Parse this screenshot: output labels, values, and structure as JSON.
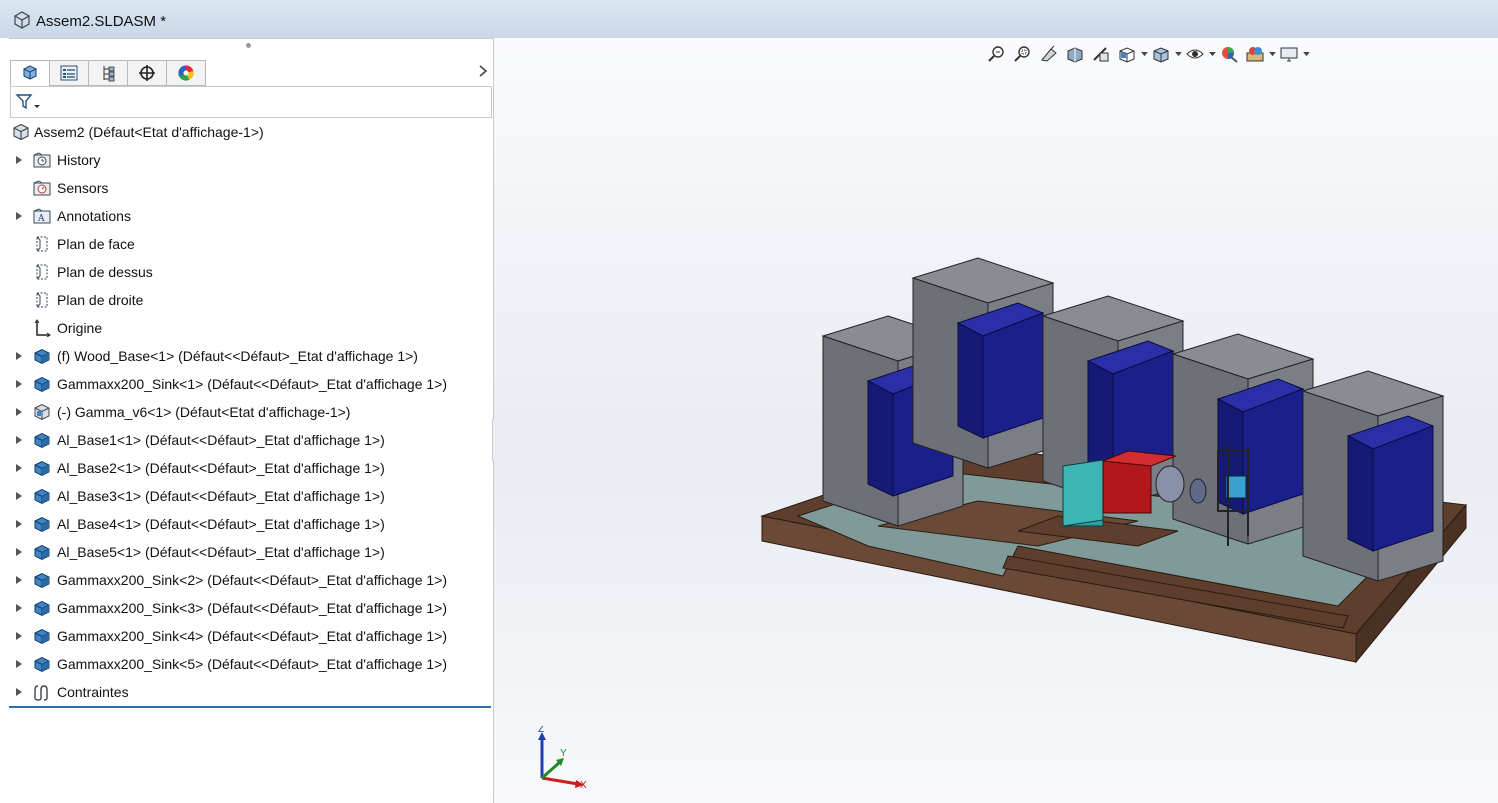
{
  "window": {
    "title": "Assem2.SLDASM *",
    "icon": "assembly-icon"
  },
  "manager_tabs": [
    {
      "name": "featuremanager-tab",
      "icon": "assembly-tree-icon",
      "active": true
    },
    {
      "name": "propertymanager-tab",
      "icon": "property-list-icon",
      "active": false
    },
    {
      "name": "configurationmanager-tab",
      "icon": "configuration-icon",
      "active": false
    },
    {
      "name": "dimxpertmanager-tab",
      "icon": "crosshair-icon",
      "active": false
    },
    {
      "name": "displaymanager-tab",
      "icon": "color-wheel-icon",
      "active": false
    }
  ],
  "filter": {
    "icon": "funnel-icon"
  },
  "tree": {
    "root": {
      "label": "Assem2  (Défaut<Etat d'affichage-1>)",
      "icon": "assembly-icon"
    },
    "items": [
      {
        "label": "History",
        "icon": "history-folder-icon",
        "expandable": true
      },
      {
        "label": "Sensors",
        "icon": "sensor-folder-icon",
        "expandable": false
      },
      {
        "label": "Annotations",
        "icon": "annotations-folder-icon",
        "expandable": true
      },
      {
        "label": "Plan de face",
        "icon": "plane-icon",
        "expandable": false
      },
      {
        "label": "Plan de dessus",
        "icon": "plane-icon",
        "expandable": false
      },
      {
        "label": "Plan de droite",
        "icon": "plane-icon",
        "expandable": false
      },
      {
        "label": "Origine",
        "icon": "origin-icon",
        "expandable": false
      },
      {
        "label": "(f) Wood_Base<1> (Défaut<<Défaut>_Etat d'affichage 1>)",
        "icon": "part-icon",
        "expandable": true
      },
      {
        "label": "Gammaxx200_Sink<1> (Défaut<<Défaut>_Etat d'affichage 1>)",
        "icon": "part-icon",
        "expandable": true
      },
      {
        "label": "(-) Gamma_v6<1> (Défaut<Etat d'affichage-1>)",
        "icon": "subassembly-icon",
        "expandable": true
      },
      {
        "label": "Al_Base1<1> (Défaut<<Défaut>_Etat d'affichage 1>)",
        "icon": "part-icon",
        "expandable": true
      },
      {
        "label": "Al_Base2<1> (Défaut<<Défaut>_Etat d'affichage 1>)",
        "icon": "part-icon",
        "expandable": true
      },
      {
        "label": "Al_Base3<1> (Défaut<<Défaut>_Etat d'affichage 1>)",
        "icon": "part-icon",
        "expandable": true
      },
      {
        "label": "Al_Base4<1> (Défaut<<Défaut>_Etat d'affichage 1>)",
        "icon": "part-icon",
        "expandable": true
      },
      {
        "label": "Al_Base5<1> (Défaut<<Défaut>_Etat d'affichage 1>)",
        "icon": "part-icon",
        "expandable": true
      },
      {
        "label": "Gammaxx200_Sink<2> (Défaut<<Défaut>_Etat d'affichage 1>)",
        "icon": "part-icon",
        "expandable": true
      },
      {
        "label": "Gammaxx200_Sink<3> (Défaut<<Défaut>_Etat d'affichage 1>)",
        "icon": "part-icon",
        "expandable": true
      },
      {
        "label": "Gammaxx200_Sink<4> (Défaut<<Défaut>_Etat d'affichage 1>)",
        "icon": "part-icon",
        "expandable": true
      },
      {
        "label": "Gammaxx200_Sink<5> (Défaut<<Défaut>_Etat d'affichage 1>)",
        "icon": "part-icon",
        "expandable": true
      },
      {
        "label": "Contraintes",
        "icon": "mates-icon",
        "expandable": true
      }
    ]
  },
  "heads_up_toolbar": [
    "zoom-to-fit-icon",
    "zoom-to-area-icon",
    "previous-view-icon",
    "section-view-icon",
    "dynamic-annotation-icon",
    "view-orientation-icon",
    "display-style-icon",
    "hide-show-items-icon",
    "edit-appearance-icon",
    "apply-scene-icon",
    "view-settings-icon"
  ],
  "triad": {
    "x": "X",
    "y": "Y",
    "z": "Z"
  },
  "colors": {
    "board": "#5e3f2e",
    "channel": "#7f9a98",
    "heatsink": "#6e7078",
    "fan": "#1a1f8c",
    "camera": "#b0181a",
    "pcb": "#2aa0a0"
  }
}
